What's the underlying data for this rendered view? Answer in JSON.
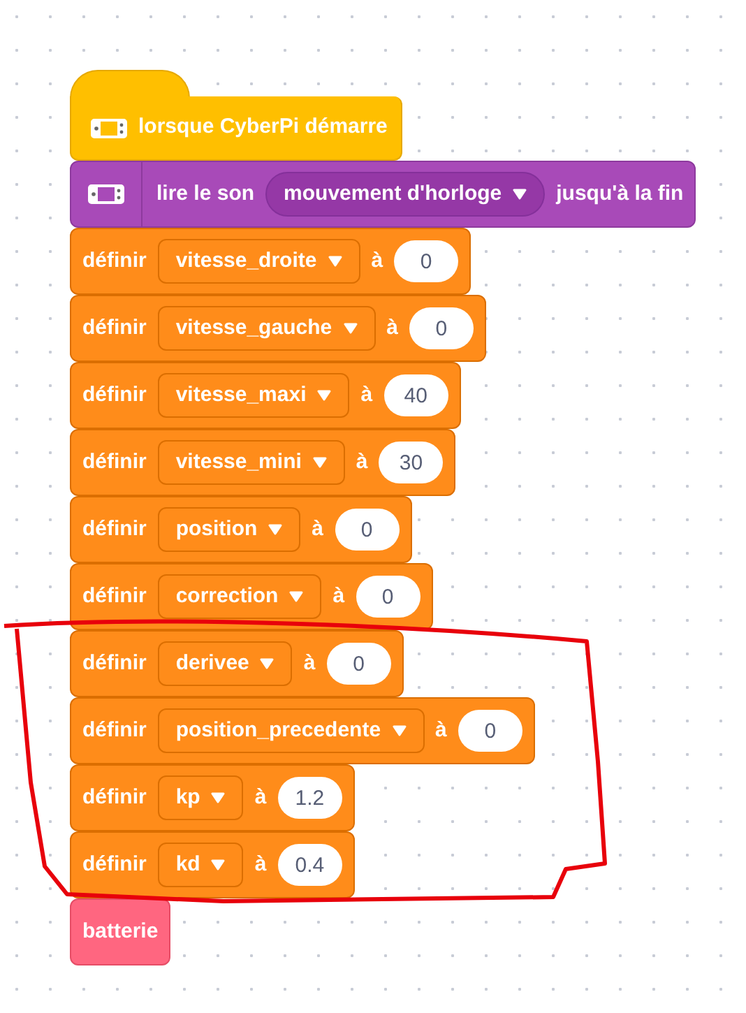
{
  "blocks": [
    {
      "kind": "hat",
      "label": "lorsque CyberPi démarre"
    },
    {
      "kind": "sound",
      "label": "lire le son",
      "option": "mouvement d'horloge",
      "suffix": "jusqu'à la fin"
    },
    {
      "kind": "set",
      "label": "définir",
      "variable": "vitesse_droite",
      "to": "à",
      "value": "0"
    },
    {
      "kind": "set",
      "label": "définir",
      "variable": "vitesse_gauche",
      "to": "à",
      "value": "0"
    },
    {
      "kind": "set",
      "label": "définir",
      "variable": "vitesse_maxi",
      "to": "à",
      "value": "40"
    },
    {
      "kind": "set",
      "label": "définir",
      "variable": "vitesse_mini",
      "to": "à",
      "value": "30"
    },
    {
      "kind": "set",
      "label": "définir",
      "variable": "position",
      "to": "à",
      "value": "0"
    },
    {
      "kind": "set",
      "label": "définir",
      "variable": "correction",
      "to": "à",
      "value": "0"
    },
    {
      "kind": "set",
      "label": "définir",
      "variable": "derivee",
      "to": "à",
      "value": "0"
    },
    {
      "kind": "set",
      "label": "définir",
      "variable": "position_precedente",
      "to": "à",
      "value": "0"
    },
    {
      "kind": "set",
      "label": "définir",
      "variable": "kp",
      "to": "à",
      "value": "1.2"
    },
    {
      "kind": "set",
      "label": "définir",
      "variable": "kd",
      "to": "à",
      "value": "0.4"
    },
    {
      "kind": "reporter",
      "label": "batterie"
    }
  ]
}
